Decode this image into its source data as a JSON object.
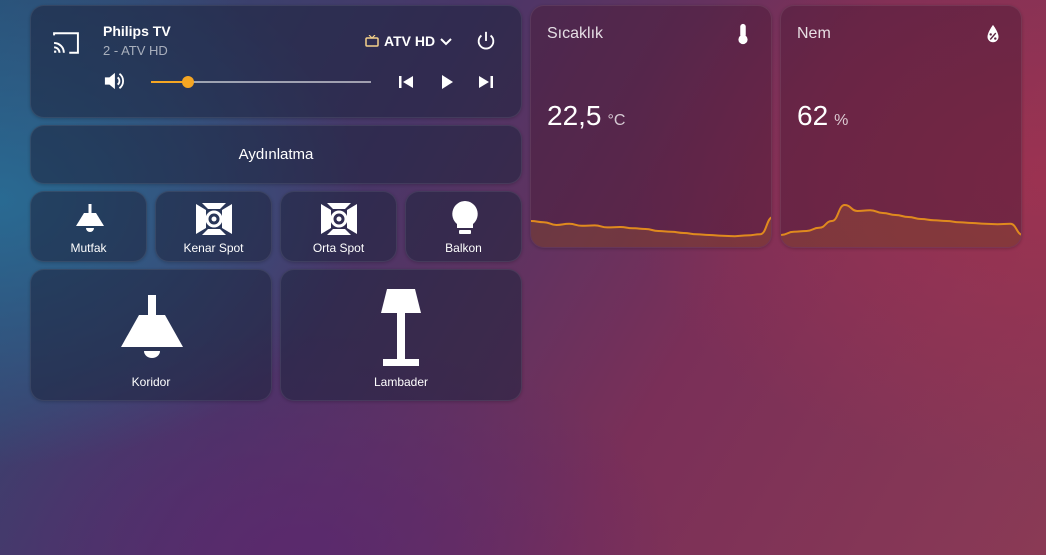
{
  "media": {
    "title": "Philips TV",
    "subtitle": "2 - ATV HD",
    "source": "ATV HD",
    "volume_level": 0.17,
    "accent": "#f5a623",
    "icons": [
      "cast-icon",
      "tv-icon",
      "chevron-down-icon",
      "power-icon",
      "volume-icon",
      "skip-previous-icon",
      "play-icon",
      "skip-next-icon"
    ]
  },
  "section": {
    "title": "Aydınlatma"
  },
  "lights": {
    "mutfak": "Mutfak",
    "kenar_spot": "Kenar Spot",
    "orta_spot": "Orta Spot",
    "balkon": "Balkon",
    "koridor": "Koridor",
    "lambader": "Lambader"
  },
  "sensors": {
    "temperature": {
      "name": "Sıcaklık",
      "value": "22,5",
      "unit": "°C",
      "icon": "thermometer-icon"
    },
    "humidity": {
      "name": "Nem",
      "value": "62",
      "unit": "%",
      "icon": "water-percent-icon"
    }
  },
  "chart_data": [
    {
      "type": "area",
      "series": [
        {
          "values": [
            0.45,
            0.42,
            0.35,
            0.38,
            0.33,
            0.34,
            0.29,
            0.3,
            0.27,
            0.25,
            0.2,
            0.18,
            0.15,
            0.12,
            0.1,
            0.08,
            0.07,
            0.09,
            0.12,
            0.55
          ]
        }
      ],
      "color": "#e08a1e"
    },
    {
      "type": "area",
      "series": [
        {
          "values": [
            0.1,
            0.18,
            0.2,
            0.28,
            0.45,
            0.85,
            0.7,
            0.72,
            0.65,
            0.6,
            0.55,
            0.5,
            0.47,
            0.45,
            0.42,
            0.4,
            0.38,
            0.37,
            0.38,
            0.1
          ]
        }
      ],
      "color": "#e08a1e"
    }
  ]
}
